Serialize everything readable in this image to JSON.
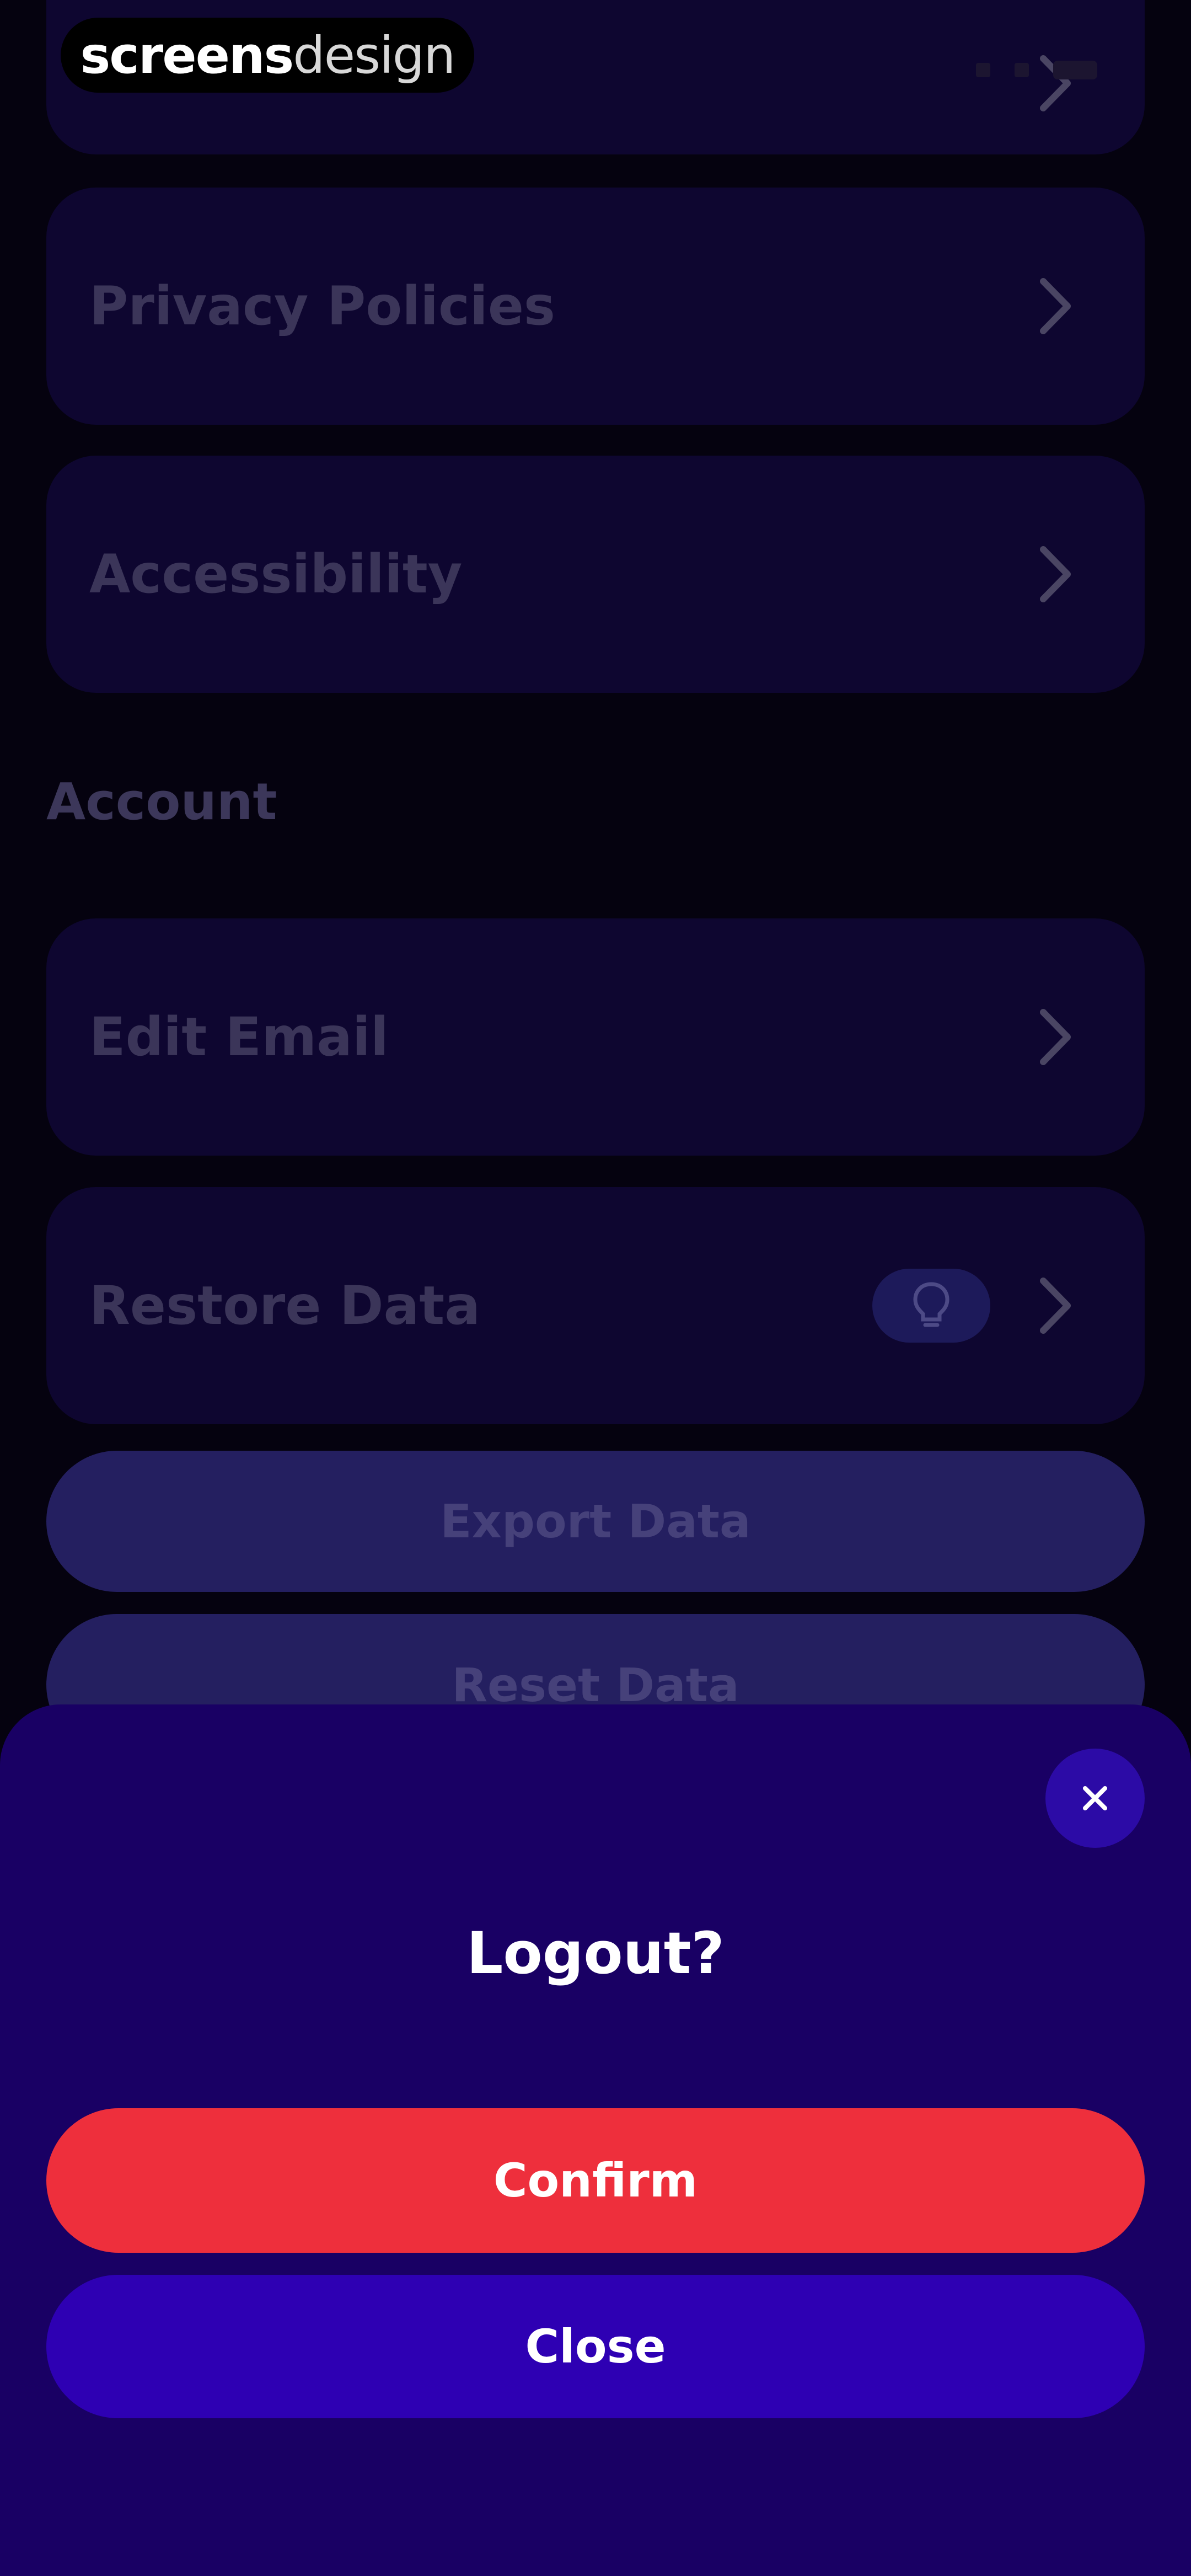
{
  "watermark": {
    "part_bold": "screens",
    "part_light": "design"
  },
  "settings": {
    "rows_top": [
      {
        "label": "",
        "icon": "chevron-right-icon"
      },
      {
        "label": "Privacy Policies",
        "icon": "chevron-right-icon"
      },
      {
        "label": "Accessibility",
        "icon": "chevron-right-icon"
      }
    ],
    "account_section_title": "Account",
    "account_rows": [
      {
        "label": "Edit Email",
        "icon": "chevron-right-icon"
      },
      {
        "label": "Restore Data",
        "icon": "chevron-right-icon",
        "badge_icon": "lightbulb-icon"
      }
    ],
    "export_label": "Export Data",
    "reset_label": "Reset Data"
  },
  "dialog": {
    "title": "Logout?",
    "confirm_label": "Confirm",
    "close_label": "Close",
    "close_icon": "close-icon"
  },
  "colors": {
    "background": "#05020f",
    "row": "#0e0630",
    "sheet": "#190064",
    "confirm": "#ee2f3c",
    "close_button": "#2e00b3",
    "secondary_button": "#241f60"
  }
}
